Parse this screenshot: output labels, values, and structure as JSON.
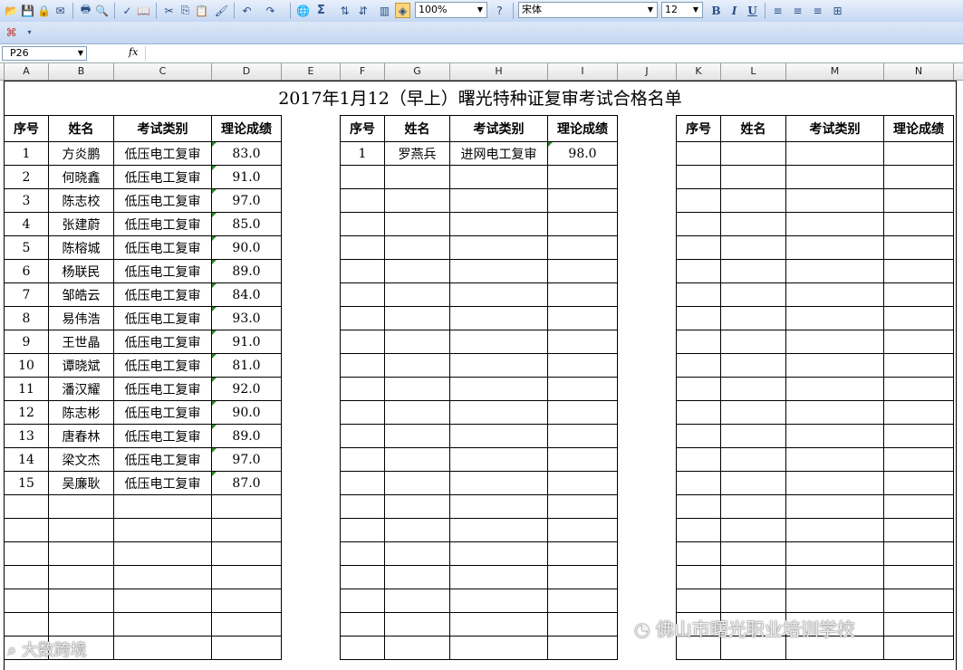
{
  "toolbar": {
    "zoom": "100%",
    "font": "宋体",
    "size": "12",
    "sigma": "Σ",
    "bold": "B",
    "italic": "I",
    "underline": "U"
  },
  "formula_bar": {
    "name_box": "P26",
    "fx": "fx",
    "formula": ""
  },
  "columns": [
    "A",
    "B",
    "C",
    "D",
    "E",
    "F",
    "G",
    "H",
    "I",
    "J",
    "K",
    "L",
    "M",
    "N"
  ],
  "sheet": {
    "title": "2017年1月12（早上）曙光特种证复审考试合格名单",
    "headers": [
      "序号",
      "姓名",
      "考试类别",
      "理论成绩"
    ],
    "group1": [
      {
        "no": "1",
        "name": "方炎鹏",
        "type": "低压电工复审",
        "score": "83.0"
      },
      {
        "no": "2",
        "name": "何晓鑫",
        "type": "低压电工复审",
        "score": "91.0"
      },
      {
        "no": "3",
        "name": "陈志校",
        "type": "低压电工复审",
        "score": "97.0"
      },
      {
        "no": "4",
        "name": "张建蔚",
        "type": "低压电工复审",
        "score": "85.0"
      },
      {
        "no": "5",
        "name": "陈榕城",
        "type": "低压电工复审",
        "score": "90.0"
      },
      {
        "no": "6",
        "name": "杨联民",
        "type": "低压电工复审",
        "score": "89.0"
      },
      {
        "no": "7",
        "name": "邹皓云",
        "type": "低压电工复审",
        "score": "84.0"
      },
      {
        "no": "8",
        "name": "易伟浩",
        "type": "低压电工复审",
        "score": "93.0"
      },
      {
        "no": "9",
        "name": "王世晶",
        "type": "低压电工复审",
        "score": "91.0"
      },
      {
        "no": "10",
        "name": "谭晓斌",
        "type": "低压电工复审",
        "score": "81.0"
      },
      {
        "no": "11",
        "name": "潘汉耀",
        "type": "低压电工复审",
        "score": "92.0"
      },
      {
        "no": "12",
        "name": "陈志彬",
        "type": "低压电工复审",
        "score": "90.0"
      },
      {
        "no": "13",
        "name": "唐春林",
        "type": "低压电工复审",
        "score": "89.0"
      },
      {
        "no": "14",
        "name": "梁文杰",
        "type": "低压电工复审",
        "score": "97.0"
      },
      {
        "no": "15",
        "name": "吴廉耿",
        "type": "低压电工复审",
        "score": "87.0"
      }
    ],
    "group2": [
      {
        "no": "1",
        "name": "罗燕兵",
        "type": "进网电工复审",
        "score": "98.0"
      }
    ]
  },
  "watermarks": {
    "left": "大数跨境",
    "right": "佛山市曙光职业培训学校"
  },
  "colors": {
    "toolbar": "#c4d7f2",
    "cell_marker": "#2b8a2b"
  }
}
